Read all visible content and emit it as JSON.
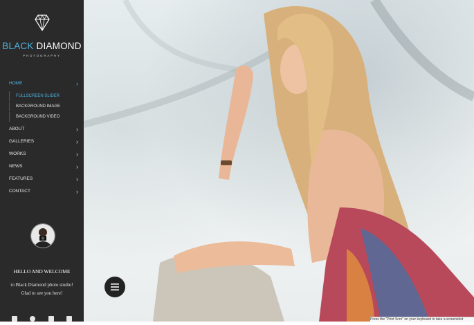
{
  "sidebar": {
    "brand": {
      "part1": "BLACK",
      "part2": "DIAMOND",
      "tagline": "PHOTOGRAPHY"
    },
    "nav": [
      {
        "label": "HOME",
        "active": true,
        "has_children": true
      },
      {
        "label": "ABOUT",
        "has_children": true
      },
      {
        "label": "GALLERIES",
        "has_children": true
      },
      {
        "label": "WORKS",
        "has_children": true
      },
      {
        "label": "NEWS",
        "has_children": true
      },
      {
        "label": "FEATURES",
        "has_children": true
      },
      {
        "label": "CONTACT",
        "has_children": true
      }
    ],
    "subnav": [
      {
        "label": "FULLSCREEN SLIDER",
        "active": true
      },
      {
        "label": "BACKGROUND IMAGE"
      },
      {
        "label": "BACKGROUND VIDEO"
      }
    ],
    "hello": "HELLO AND WELCOME",
    "welcome_line1": "to Black Diamond photo studio!",
    "welcome_line2": "Glad to see you here!",
    "social": [
      "facebook-icon",
      "pinterest-icon",
      "instagram-icon",
      "flickr-icon"
    ]
  },
  "colors": {
    "accent": "#4fb3e0",
    "sidebar_bg": "#2a2a2a"
  },
  "hero": {
    "menu_icon": "hamburger-icon"
  },
  "tooltip": "Press the \"Print Scrn\" on your keyboard to take a screenshot"
}
